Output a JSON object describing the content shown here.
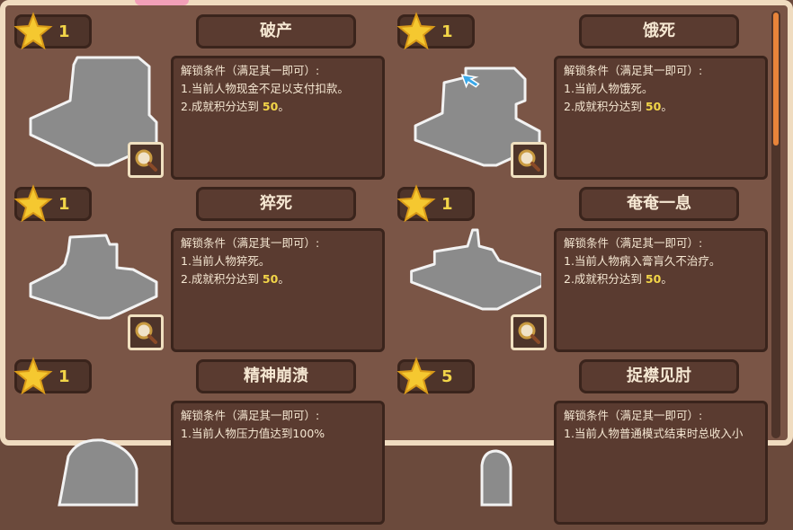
{
  "condition_header": "解锁条件（满足其一即可）:",
  "score_prefix": "2.成就积分达到",
  "score_value": "50",
  "score_suffix": "。",
  "accent_color": "#f2d548",
  "icons": {
    "star": "star-icon",
    "magnify": "magnifier-icon",
    "cursor": "cursor-arrow-icon"
  },
  "cards": [
    {
      "stars": "1",
      "title": "破产",
      "condition1": "1.当前人物现金不足以支付扣款。"
    },
    {
      "stars": "1",
      "title": "饿死",
      "condition1": "1.当前人物饿死。"
    },
    {
      "stars": "1",
      "title": "猝死",
      "condition1": "1.当前人物猝死。"
    },
    {
      "stars": "1",
      "title": "奄奄一息",
      "condition1": "1.当前人物病入膏肓久不治疗。"
    },
    {
      "stars": "1",
      "title": "精神崩溃",
      "condition1": "1.当前人物压力值达到100%"
    },
    {
      "stars": "5",
      "title": "捉襟见肘",
      "condition1": "1.当前人物普通模式结束时总收入小"
    }
  ]
}
